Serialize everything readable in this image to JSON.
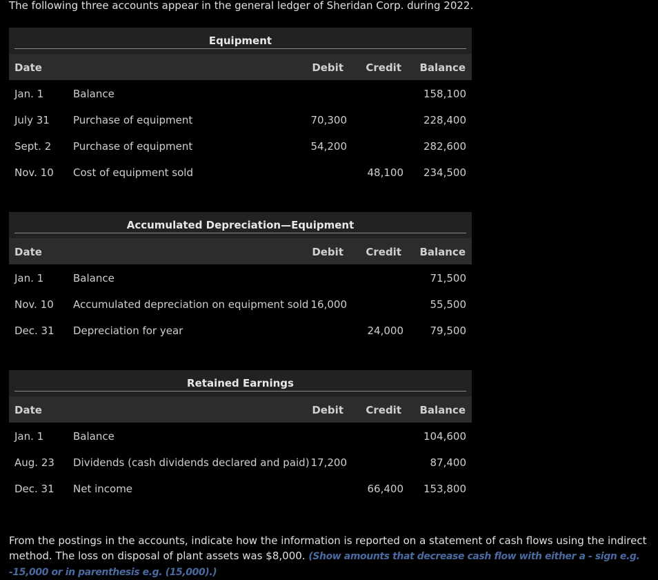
{
  "intro": "The following three accounts appear in the general ledger of Sheridan Corp. during 2022.",
  "ledgers": [
    {
      "title": "Equipment",
      "headers": {
        "date": "Date",
        "debit": "Debit",
        "credit": "Credit",
        "balance": "Balance"
      },
      "rows": [
        {
          "date": "Jan. 1",
          "desc": "Balance",
          "debit": "",
          "credit": "",
          "balance": "158,100"
        },
        {
          "date": "July 31",
          "desc": "Purchase of equipment",
          "debit": "70,300",
          "credit": "",
          "balance": "228,400"
        },
        {
          "date": "Sept. 2",
          "desc": "Purchase of equipment",
          "debit": "54,200",
          "credit": "",
          "balance": "282,600"
        },
        {
          "date": "Nov. 10",
          "desc": "Cost of equipment sold",
          "debit": "",
          "credit": "48,100",
          "balance": "234,500"
        }
      ]
    },
    {
      "title": "Accumulated Depreciation—Equipment",
      "headers": {
        "date": "Date",
        "debit": "Debit",
        "credit": "Credit",
        "balance": "Balance"
      },
      "rows": [
        {
          "date": "Jan. 1",
          "desc": "Balance",
          "debit": "",
          "credit": "",
          "balance": "71,500"
        },
        {
          "date": "Nov. 10",
          "desc": "Accumulated depreciation on equipment sold",
          "debit": "16,000",
          "credit": "",
          "balance": "55,500"
        },
        {
          "date": "Dec. 31",
          "desc": "Depreciation for year",
          "debit": "",
          "credit": "24,000",
          "balance": "79,500"
        }
      ]
    },
    {
      "title": "Retained Earnings",
      "headers": {
        "date": "Date",
        "debit": "Debit",
        "credit": "Credit",
        "balance": "Balance"
      },
      "rows": [
        {
          "date": "Jan. 1",
          "desc": "Balance",
          "debit": "",
          "credit": "",
          "balance": "104,600"
        },
        {
          "date": "Aug. 23",
          "desc": "Dividends (cash dividends declared and paid)",
          "debit": "17,200",
          "credit": "",
          "balance": "87,400"
        },
        {
          "date": "Dec. 31",
          "desc": "Net income",
          "debit": "",
          "credit": "66,400",
          "balance": "153,800"
        }
      ]
    }
  ],
  "footer": {
    "text": "From the postings in the accounts, indicate how the information is reported on a statement of cash flows using the indirect method. The loss on disposal of plant assets was $8,000.",
    "hint": "(Show amounts that decrease cash flow with either a - sign e.g. -15,000 or in parenthesis e.g. (15,000).)"
  }
}
